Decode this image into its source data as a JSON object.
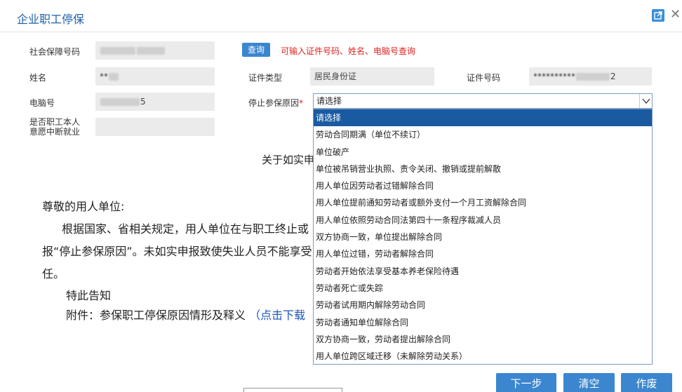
{
  "window": {
    "title": "企业职工停保"
  },
  "form": {
    "ssn_label": "社会保障号码",
    "query_label": "查询",
    "query_hint": "可输入证件号码、姓名、电脑号查询",
    "name_label": "姓名",
    "name_value": "**",
    "id_type_label": "证件类型",
    "id_type_value": "居民身份证",
    "id_no_label": "证件号码",
    "id_no_value_prefix": "**********",
    "id_no_value_suffix": "2",
    "pc_no_label": "电脑号",
    "pc_no_value_suffix": "5",
    "stop_reason_label": "停止参保原因",
    "required_mark": "*",
    "stop_reason_value": "请选择",
    "voluntary_label_line1": "是否职工本人",
    "voluntary_label_line2": "意愿中断就业"
  },
  "notice": {
    "title": "关于如实申",
    "greeting": "尊敬的用人单位:",
    "line1": "根据国家、省相关规定，用人单位在与职工终止或",
    "line2": "报“停止参保原因”。未如实申报致使失业人员不能享受",
    "line3": "任。",
    "closing": "特此告知",
    "attachment_label": "附件：参保职工停保原因情形及释义",
    "download_link": "（点击下载"
  },
  "dropdown": {
    "options": [
      "请选择",
      "劳动合同期满（单位不续订）",
      "单位破产",
      "单位被吊销营业执照、责令关闭、撤销或提前解散",
      "用人单位因劳动者过错解除合同",
      "用人单位提前通知劳动者或额外支付一个月工资解除合同",
      "用人单位依照劳动合同法第四十一条程序裁减人员",
      "双方协商一致，单位提出解除合同",
      "用人单位过错，劳动者解除合同",
      "劳动者开始依法享受基本养老保险待遇",
      "劳动者死亡或失踪",
      "劳动者试用期内解除劳动合同",
      "劳动者通知单位解除合同",
      "双方协商一致，劳动者提出解除合同",
      "用人单位跨区域迁移（未解除劳动关系）"
    ]
  },
  "buttons": {
    "next": "下一步",
    "clear": "清空",
    "void": "作废"
  },
  "colors": {
    "primary": "#3b86cf",
    "selected": "#1a5aa0",
    "warning": "#dd2222",
    "title": "#1f5fa8"
  }
}
